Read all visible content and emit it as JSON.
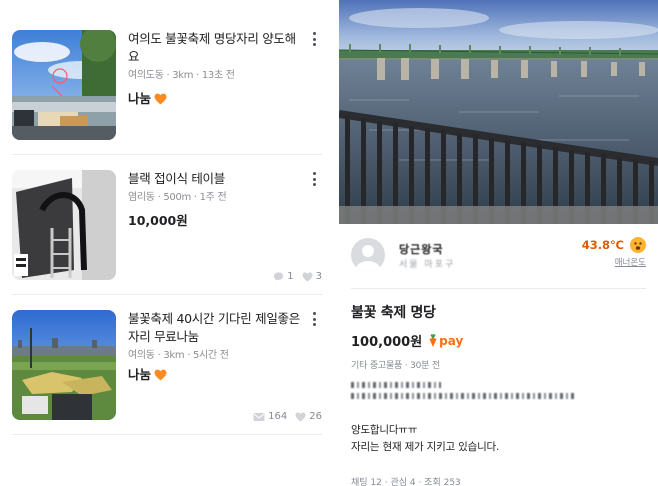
{
  "feed": {
    "items": [
      {
        "title": "여의도 불꽃축제 명당자리 양도해요",
        "meta": "여의도동 · 3km · 13초 전",
        "price": "나눔",
        "chat_count": "",
        "like_count": ""
      },
      {
        "title": "블랙 접이식 테이블",
        "meta": "염리동 · 500m · 1주 전",
        "price": "10,000원",
        "chat_count": "1",
        "like_count": "3"
      },
      {
        "title": "불꽃축제 40시간 기다린 제일좋은자리 무료나눔",
        "meta": "여의동 · 3km · 5시간 전",
        "price": "나눔",
        "chat_count": "164",
        "like_count": "26"
      }
    ]
  },
  "detail": {
    "seller": {
      "name": "당근왕국",
      "location": "서울 마포구",
      "temperature": "43.8℃",
      "manner_label": "매너온도"
    },
    "title": "불꽃 축제 명당",
    "price": "100,000원",
    "pay_label": "pay",
    "category_time": "기타 중고물품 · 30분 전",
    "description": [
      "양도합니다ㅠㅠ",
      "자리는 현재 제가 지키고 있습니다."
    ],
    "footer": "채팅 12 · 관심 4 · 조회 253"
  },
  "colors": {
    "accent": "#ff6f0f",
    "temperature": "#de5d06",
    "text": "#212124",
    "muted": "#868b94"
  },
  "icons": {
    "more": "more-vertical-icon",
    "chat": "chat-bubble-icon",
    "like": "heart-outline-icon",
    "free": "orange-heart-icon",
    "pay": "carrot-icon",
    "face": "smiley-face-icon"
  }
}
